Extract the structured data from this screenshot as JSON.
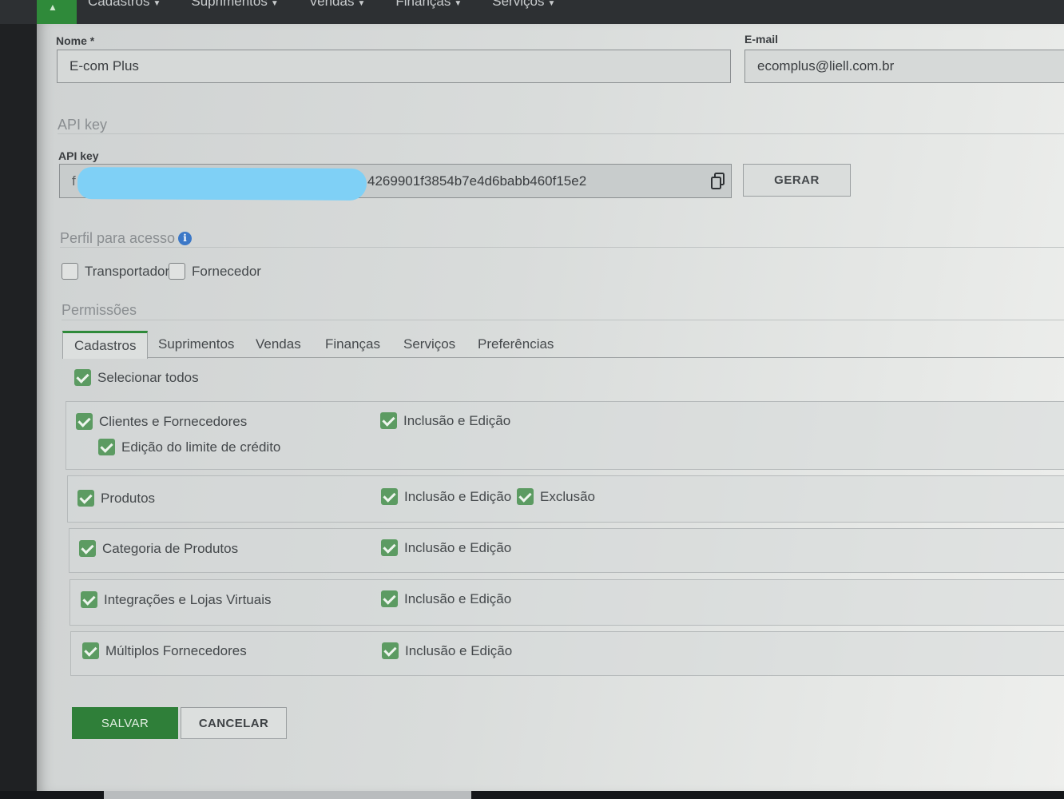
{
  "nav": {
    "items": [
      "Cadastros",
      "Suprimentos",
      "Vendas",
      "Finanças",
      "Serviços"
    ]
  },
  "form": {
    "nome_label": "Nome *",
    "nome_value": "E-com Plus",
    "email_label": "E-mail",
    "email_value": "ecomplus@liell.com.br"
  },
  "api": {
    "section_title": "API key",
    "label": "API key",
    "prefix": "f",
    "value_visible": "4269901f3854b7e4d6babb460f15e2",
    "generate_label": "GERAR"
  },
  "perfil": {
    "title": "Perfil para acesso",
    "options": [
      {
        "label": "Transportador",
        "checked": false
      },
      {
        "label": "Fornecedor",
        "checked": false
      }
    ]
  },
  "permissoes": {
    "title": "Permissões",
    "tabs": [
      "Cadastros",
      "Suprimentos",
      "Vendas",
      "Finanças",
      "Serviços",
      "Preferências"
    ],
    "active_tab": "Cadastros",
    "select_all": "Selecionar todos",
    "rows": [
      {
        "label": "Clientes e Fornecedores",
        "sub": "Edição do limite de crédito",
        "actions": [
          "Inclusão e Edição"
        ]
      },
      {
        "label": "Produtos",
        "actions": [
          "Inclusão e Edição",
          "Exclusão"
        ]
      },
      {
        "label": "Categoria de Produtos",
        "actions": [
          "Inclusão e Edição"
        ]
      },
      {
        "label": "Integrações e Lojas Virtuais",
        "actions": [
          "Inclusão e Edição"
        ]
      },
      {
        "label": "Múltiplos Fornecedores",
        "actions": [
          "Inclusão e Edição"
        ]
      }
    ]
  },
  "buttons": {
    "save": "SALVAR",
    "cancel": "CANCELAR"
  },
  "colors": {
    "brand_green": "#2f7f39",
    "checkbox_green": "#5c9b62",
    "info_blue": "#3b78c7"
  }
}
